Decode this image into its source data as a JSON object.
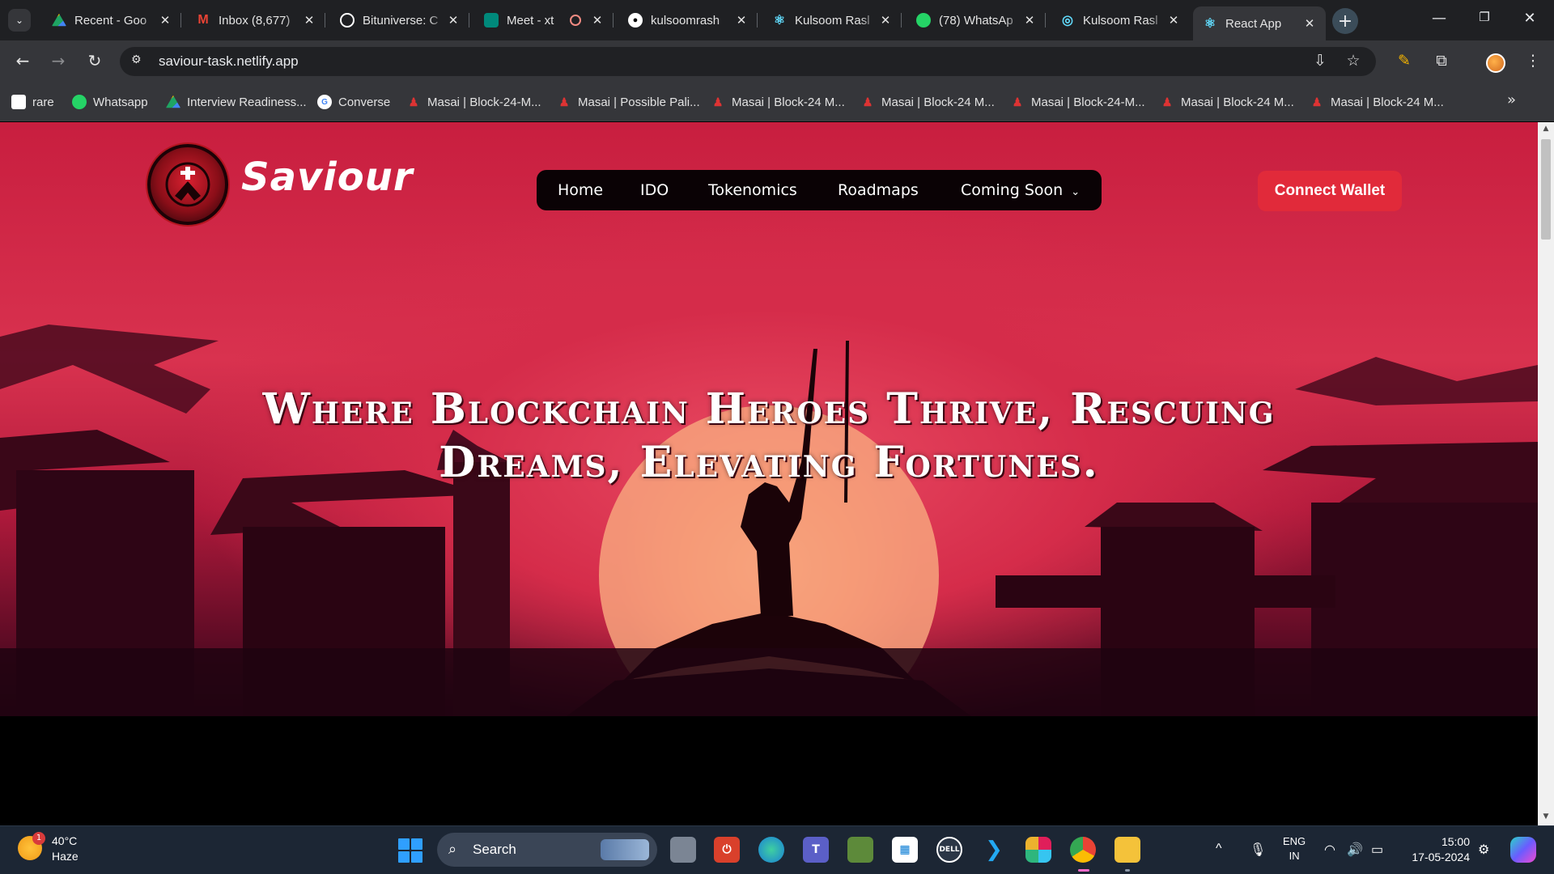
{
  "browser": {
    "tabs": [
      {
        "title": "Recent - Goo",
        "icon": "google-drive-icon",
        "color": "#1fa463"
      },
      {
        "title": "Inbox (8,677)",
        "icon": "gmail-icon",
        "color": "#ea4335"
      },
      {
        "title": "Bituniverse: C",
        "icon": "openai-icon",
        "color": "#ffffff"
      },
      {
        "title": "Meet - xt",
        "icon": "google-meet-icon",
        "color": "#00897b"
      },
      {
        "title": "kulsoomrash",
        "icon": "github-icon",
        "color": "#ffffff"
      },
      {
        "title": "Kulsoom Rasl",
        "icon": "react-icon",
        "color": "#61dafb"
      },
      {
        "title": "(78) WhatsAp",
        "icon": "whatsapp-icon",
        "color": "#25d366"
      },
      {
        "title": "Kulsoom Rasl",
        "icon": "netlify-icon",
        "color": "#61dafb"
      },
      {
        "title": "React App",
        "icon": "react-icon",
        "color": "#61dafb"
      }
    ],
    "url": "saviour-task.netlify.app",
    "bookmarks": [
      {
        "label": "rare",
        "icon": "page-icon"
      },
      {
        "label": "Whatsapp",
        "icon": "whatsapp-icon"
      },
      {
        "label": "Interview Readiness...",
        "icon": "google-drive-icon"
      },
      {
        "label": "Converse",
        "icon": "google-icon"
      },
      {
        "label": "Masai | Block-24-M...",
        "icon": "masai-icon"
      },
      {
        "label": "Masai | Possible Pali...",
        "icon": "masai-icon"
      },
      {
        "label": "Masai | Block-24 M...",
        "icon": "masai-icon"
      },
      {
        "label": "Masai | Block-24 M...",
        "icon": "masai-icon"
      },
      {
        "label": "Masai | Block-24-M...",
        "icon": "masai-icon"
      },
      {
        "label": "Masai | Block-24 M...",
        "icon": "masai-icon"
      },
      {
        "label": "Masai | Block-24 M...",
        "icon": "masai-icon"
      }
    ]
  },
  "page": {
    "logo_text": "Saviour",
    "nav": [
      "Home",
      "IDO",
      "Tokenomics",
      "Roadmaps",
      "Coming Soon"
    ],
    "connect_label": "Connect Wallet",
    "hero_title_line1": "Where Blockchain Heroes Thrive, Rescuing",
    "hero_title_line2": "Dreams, Elevating Fortunes.",
    "accent": "#e12a3a"
  },
  "taskbar": {
    "temperature": "40°C",
    "weather": "Haze",
    "weather_badge": "1",
    "search_label": "Search",
    "lang_top": "ENG",
    "lang_bottom": "IN",
    "time": "15:00",
    "date": "17-05-2024"
  }
}
